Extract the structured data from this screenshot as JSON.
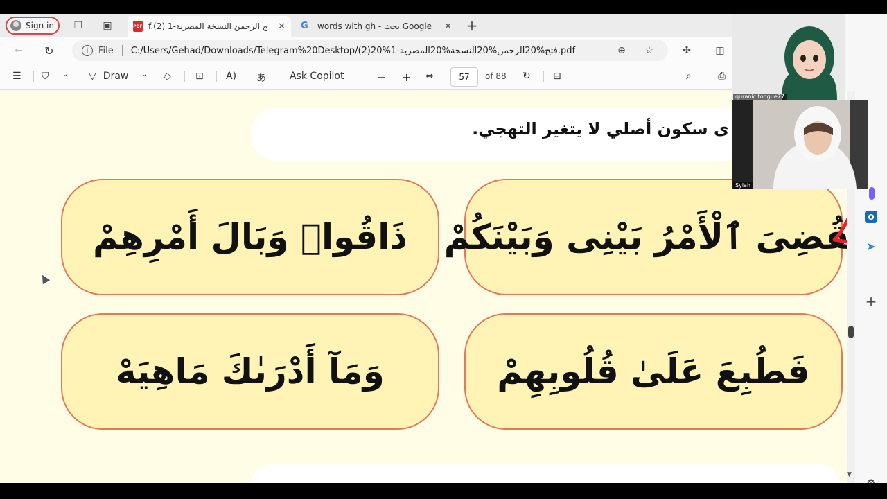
{
  "browser": {
    "sign_in_label": "Sign in",
    "tabs": [
      {
        "title": "f.(2) فتح الرحمن النسخة المصرية-1",
        "badge": "PDF",
        "active": true
      },
      {
        "title": "words with gh - بحث Google",
        "badge": "G",
        "active": false
      }
    ],
    "new_tab_glyph": "+",
    "close_glyph": "✕"
  },
  "address": {
    "file_label": "File",
    "url": "C:/Users/Gehad/Downloads/Telegram%20Desktop/(2)20%1-فتح%20الرحمن%20النسخة%20المصرية.pdf"
  },
  "pdf_toolbar": {
    "draw_label": "Draw",
    "ask_copilot_label": "Ask Copilot",
    "page_current": "57",
    "page_total": "of 88",
    "minus": "−",
    "plus": "+"
  },
  "document": {
    "instruction": "ى سكون أصلي لا يتغير التهجي.",
    "cards": [
      {
        "text": "لَقُضِىَ ٱلْأَمْرُ بَيْنِى وَبَيْنَكُمْ",
        "position": "top-right"
      },
      {
        "text": "ذَاقُوا۟ وَبَالَ أَمْرِهِمْ",
        "position": "top-left"
      },
      {
        "text": "فَطُبِعَ عَلَىٰ قُلُوبِهِمْ",
        "position": "bottom-right"
      },
      {
        "text": "وَمَآ أَدْرَىٰكَ مَاهِيَهْ",
        "position": "bottom-left"
      }
    ]
  },
  "participants": [
    {
      "name": "quranic tongue77"
    },
    {
      "name": "Sylah"
    }
  ],
  "colors": {
    "card_fill": "#fff3b5",
    "card_border": "#e07a5a",
    "page_bg": "#fffde6",
    "annotation_red": "#e3222b"
  }
}
